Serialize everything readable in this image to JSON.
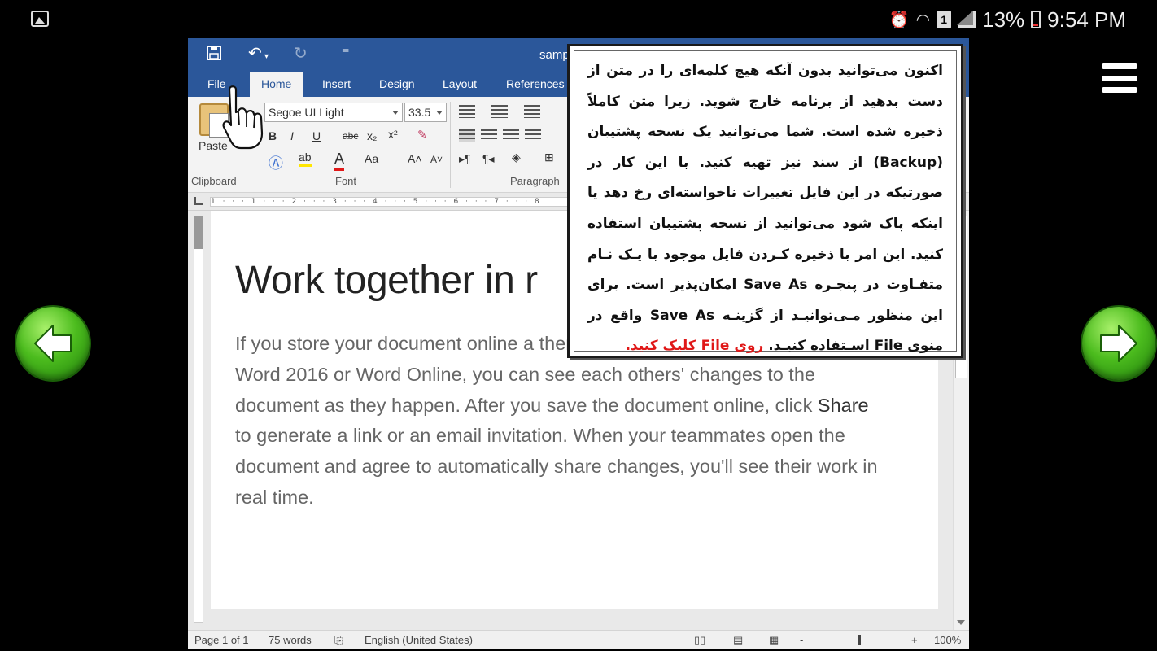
{
  "status_bar": {
    "battery": "13%",
    "clock": "9:54 PM",
    "sim_slot": "1"
  },
  "word": {
    "doc_title": "samp",
    "tabs": [
      "File",
      "Home",
      "Insert",
      "Design",
      "Layout",
      "References"
    ],
    "ribbon": {
      "paste_label": "Paste",
      "font_name": "Segoe UI Light",
      "font_size": "33.5",
      "group_clipboard": "Clipboard",
      "group_font": "Font",
      "group_paragraph": "Paragraph",
      "bold": "B",
      "italic": "I",
      "underline": "U",
      "strikethrough": "abc",
      "subscript": "x₂",
      "superscript": "x²",
      "font_color": "A",
      "change_case": "Aa",
      "grow_font": "A˄",
      "shrink_font": "A˅"
    },
    "ruler_marks": "1 · · · 1 · · · 2 · · · 3 · · · 4 · · · 5 · · · 6 · · · 7 · · · 8",
    "document": {
      "heading": "Work together in r",
      "body_before": "If you store your document online a then share it with colleagues who use Word 2016 or Word Online, you can see each others' changes to the document as they happen. After you save the document online, click ",
      "body_share": "Share",
      "body_after": " to generate a link or an email invitation. When your teammates open the document and agree to automatically share changes, you'll see their work in real time."
    },
    "statusbar": {
      "page": "Page 1 of 1",
      "words": "75 words",
      "language": "English (United States)",
      "zoom": "100%",
      "zoom_minus": "-",
      "zoom_plus": "+"
    }
  },
  "callout": {
    "text_main": "اکنون می‌توانید بدون آنکه هیچ کلمه‌ای را در متن از دست بدهید از برنامه خارج شوید. زیرا متن کاملاً ذخیره شده است. شما می‌توانید یک نسخه پشتیبان (Backup) از سند نیز تهیه کنید. با این کار در صورتیکه در این فایل تغییرات ناخواسته‌ای رخ دهد یا اینکه پاک شود می‌توانید از نسخه پشتیبان استفاده کنید. این امر با ذخیره کـردن فایل موجود با یـک نـام متفـاوت در پنجـره  Save As امکان‌پذیر است. برای این منظور مـی‌توانیـد از گزینـه Save As واقع در منوی File اسـتفاده کنیـد.",
    "text_red": " روی File کلیک کنید.",
    "accent_red": "#e01818"
  },
  "colors": {
    "word_blue": "#2b579a",
    "arrow_green": "#4cbc1e"
  }
}
